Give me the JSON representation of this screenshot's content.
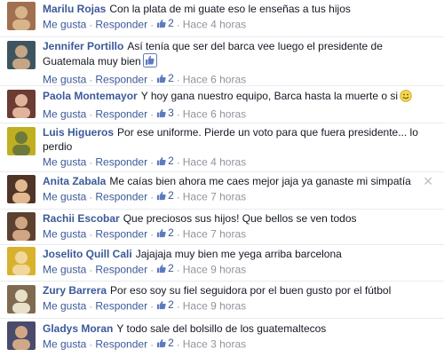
{
  "actions": {
    "like": "Me gusta",
    "reply": "Responder",
    "sep": "·"
  },
  "comments": [
    {
      "author": "Marilu Rojas",
      "text": "Con la plata de mi guate eso le enseñas a tus hijos",
      "likes": "2",
      "time": "Hace 4 horas",
      "avatar": "#a07050",
      "avatar2": "#d8b48a"
    },
    {
      "author": "Jennifer Portillo",
      "text": "Así tenía que ser del barca vee luego el presidente de Guatemala muy bien",
      "likes": "2",
      "time": "Hace 6 horas",
      "avatar": "#3d5560",
      "avatar2": "#c6a585"
    },
    {
      "author": "Paola Montemayor",
      "text": "Y hoy gana nuestro equipo, Barca hasta la muerte o si",
      "likes": "3",
      "time": "Hace 6 horas",
      "avatar": "#6b3b34",
      "avatar2": "#e0b49a"
    },
    {
      "author": "Luis Higueros",
      "text": "Por ese uniforme. Pierde un voto para que fuera presidente... lo perdio",
      "likes": "2",
      "time": "Hace 4 horas",
      "avatar": "#c0b020",
      "avatar2": "#6d7a3c"
    },
    {
      "author": "Anita Zabala",
      "text": "Me caías bien ahora me caes mejor jaja ya ganaste mi simpatía",
      "likes": "2",
      "time": "Hace 7 horas",
      "avatar": "#4e3527",
      "avatar2": "#e3b990"
    },
    {
      "author": "Rachii Escobar",
      "text": "Que preciosos sus hijos! Que bellos se ven todos",
      "likes": "2",
      "time": "Hace 7 horas",
      "avatar": "#5c4030",
      "avatar2": "#cfa684"
    },
    {
      "author": "Joselito Quill Cali",
      "text": "Jajajaja muy bien me yega arriba barcelona",
      "likes": "2",
      "time": "Hace 9 horas",
      "avatar": "#d8b22c",
      "avatar2": "#f1d79a"
    },
    {
      "author": "Zury Barrera",
      "text": "Por eso soy su fiel seguidora por el buen gusto por el fútbol",
      "likes": "2",
      "time": "Hace 9 horas",
      "avatar": "#7d6a50",
      "avatar2": "#e8e0c8"
    },
    {
      "author": "Gladys Moran",
      "text": "Y todo sale del bolsillo de los guatemaltecos",
      "likes": "2",
      "time": "Hace 3 horas",
      "avatar": "#4a4a6a",
      "avatar2": "#d1a887"
    }
  ],
  "inline_icons": {
    "1": "thumbs-up-emoticon",
    "2": "smiley-emoticon"
  },
  "close_symbol": "✕",
  "colors": {
    "link": "#3b5998",
    "meta": "#90949c",
    "text": "#141823"
  }
}
